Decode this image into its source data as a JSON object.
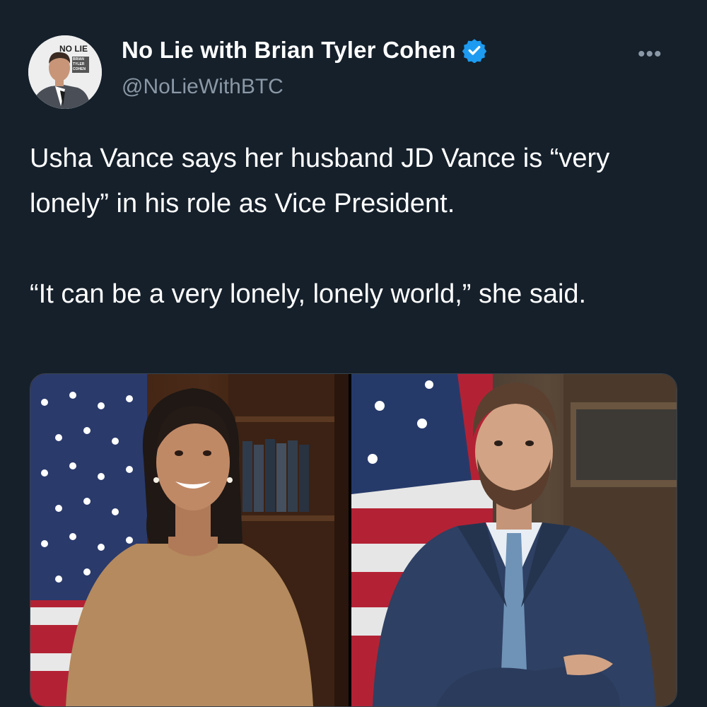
{
  "account": {
    "display_name": "No Lie with Brian Tyler Cohen",
    "handle": "@NoLieWithBTC",
    "avatar_logo_title": "NO LIE",
    "avatar_logo_subtitle": "BRIAN TYLER COHEN",
    "verified_color": "#1d9bf0"
  },
  "menu": {
    "more_label": "•••"
  },
  "tweet": {
    "text": "Usha Vance says her husband JD Vance is “very lonely” in his role as Vice President.\n\n“It can be a very lonely, lonely world,” she said."
  },
  "media": {
    "images": [
      "portrait-woman-flag-bookshelf",
      "portrait-man-flag-suit"
    ]
  },
  "colors": {
    "background": "#15202b",
    "secondary_text": "#8b98a5",
    "border": "#38444d"
  }
}
